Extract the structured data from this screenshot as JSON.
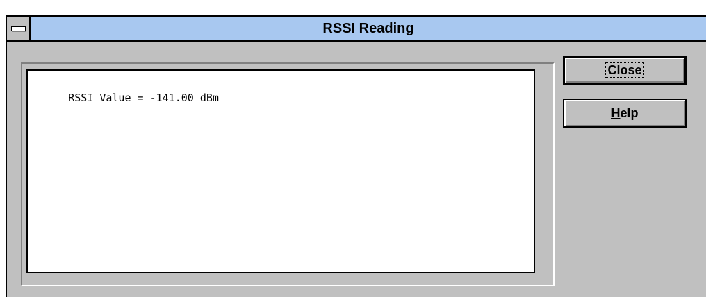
{
  "window": {
    "title": "RSSI Reading"
  },
  "output": {
    "text": "RSSI Value = -141.00 dBm"
  },
  "buttons": {
    "close_label": "Close",
    "help_mnemonic": "H",
    "help_rest": "elp"
  },
  "icons": {
    "system_menu": "system-menu-icon"
  },
  "colors": {
    "titlebar": "#a8c8f0",
    "window_bg": "#c0c0c0"
  }
}
